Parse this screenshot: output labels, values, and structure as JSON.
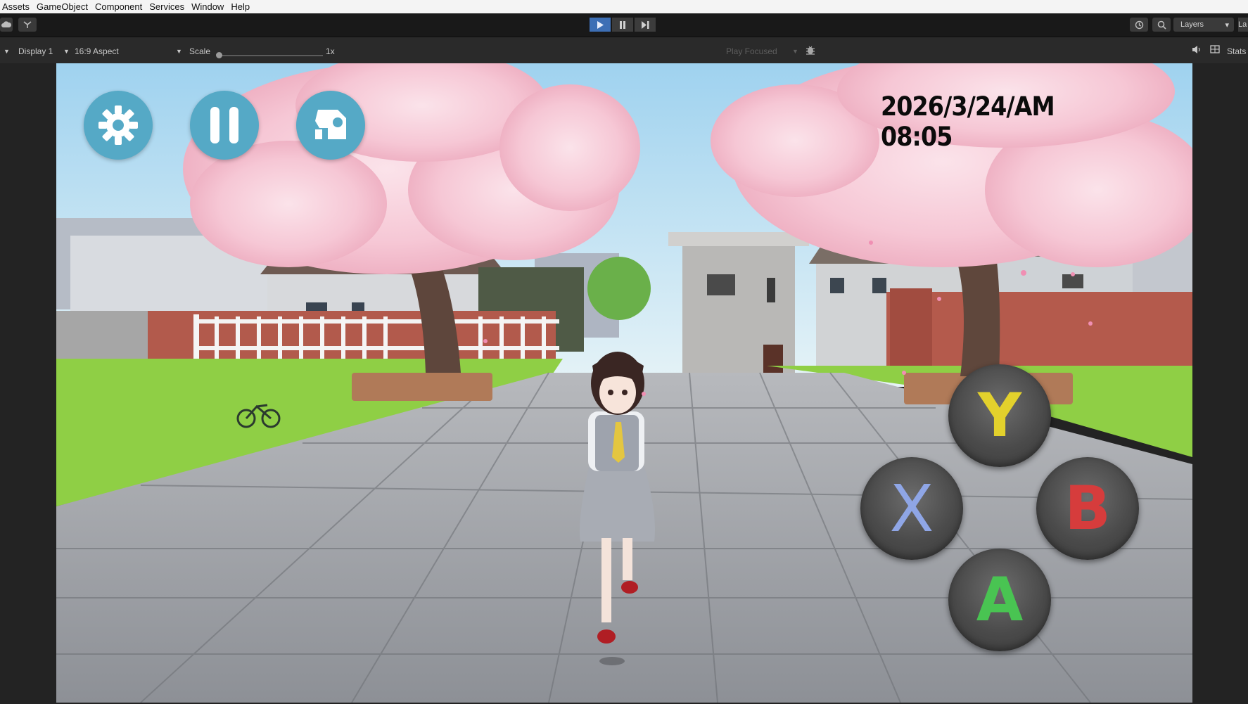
{
  "menu": [
    "Assets",
    "GameObject",
    "Component",
    "Services",
    "Window",
    "Help"
  ],
  "toolbar": {
    "layers_label": "Layers",
    "right_clip_label": "La"
  },
  "game_view": {
    "display": "Display 1",
    "aspect": "16:9 Aspect",
    "scale_label": "Scale",
    "scale_value": "1x",
    "play_mode": "Play Focused",
    "stats_label": "Stats"
  },
  "hud": {
    "datetime": "2026/3/24/AM 08:05",
    "buttons": [
      "settings-icon",
      "pause-icon",
      "camera-icon"
    ],
    "pad": {
      "y": {
        "label": "Y",
        "color": "#e3d12c"
      },
      "x": {
        "label": "X",
        "color": "#8fa6e6"
      },
      "b": {
        "label": "B",
        "color": "#d63c3c"
      },
      "a": {
        "label": "A",
        "color": "#49c452"
      }
    }
  },
  "colors": {
    "hud_button": "#55a9c6",
    "play_active": "#3d6fb5",
    "sky": "#bfe3f5",
    "grass": "#8fd44a"
  }
}
